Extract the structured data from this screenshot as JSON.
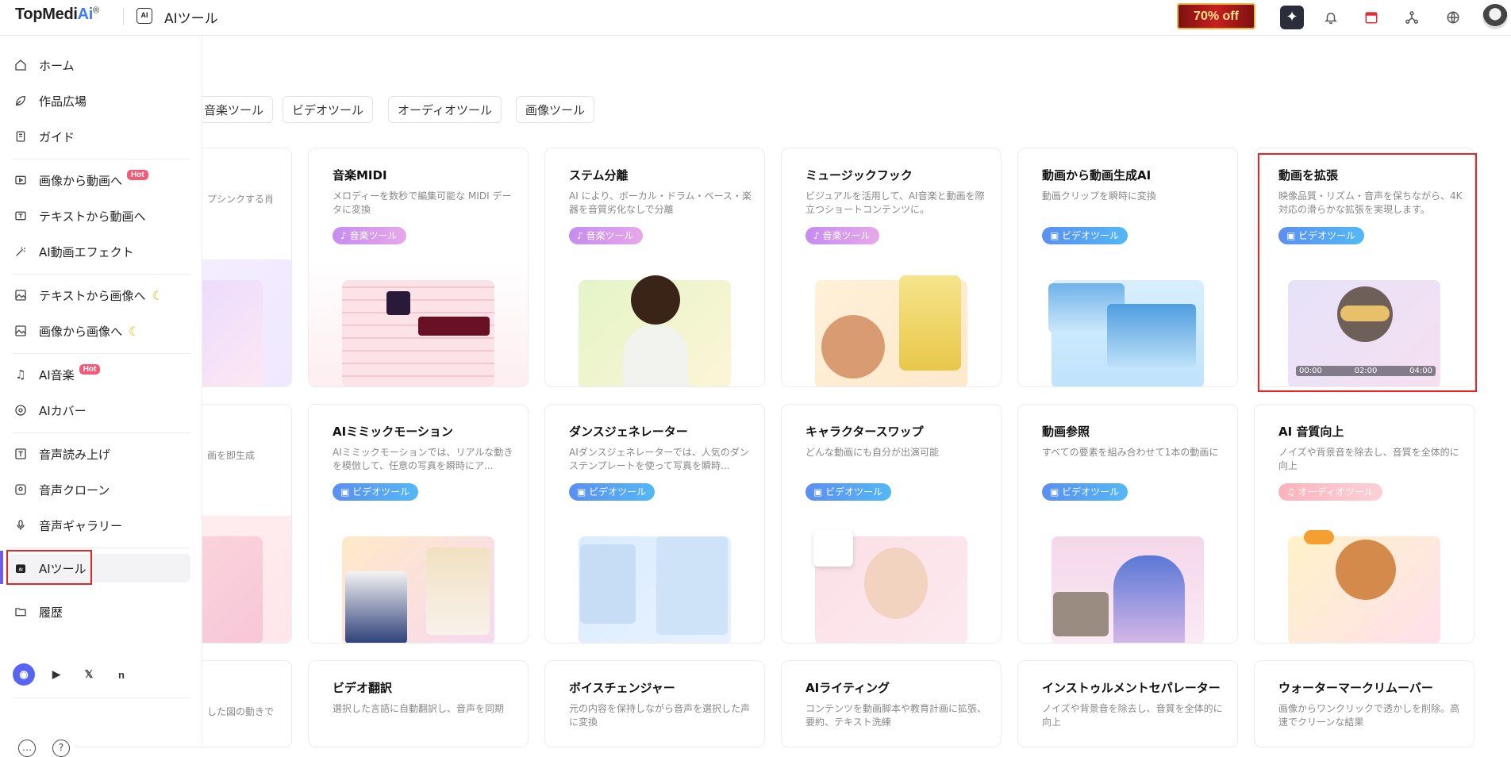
{
  "app": {
    "logo_main": "TopMedi",
    "logo_ai": "Ai",
    "logo_reg": "®",
    "section_icon": "AI",
    "section_title": "AIツール",
    "promo_label": "70% off"
  },
  "sidebar": {
    "items": [
      {
        "label": "ホーム",
        "icon": "home-icon"
      },
      {
        "label": "作品広場",
        "icon": "leaf-icon"
      },
      {
        "label": "ガイド",
        "icon": "guide-icon"
      },
      {
        "label": "画像から動画へ",
        "icon": "image-video-icon",
        "badge": "Hot"
      },
      {
        "label": "テキストから動画へ",
        "icon": "text-video-icon"
      },
      {
        "label": "AI動画エフェクト",
        "icon": "magic-wand-icon"
      },
      {
        "label": "テキストから画像へ",
        "icon": "text-image-icon"
      },
      {
        "label": "画像から画像へ",
        "icon": "image-image-icon"
      },
      {
        "label": "AI音楽",
        "icon": "music-note-icon",
        "badge": "Hot"
      },
      {
        "label": "AIカバー",
        "icon": "disc-icon"
      },
      {
        "label": "音声読み上げ",
        "icon": "tts-icon"
      },
      {
        "label": "音声クローン",
        "icon": "voice-clone-icon"
      },
      {
        "label": "音声ギャラリー",
        "icon": "microphone-icon"
      },
      {
        "label": "AIツール",
        "icon": "ai-tools-icon"
      },
      {
        "label": "履歴",
        "icon": "folder-icon"
      }
    ],
    "social": [
      "discord-icon",
      "youtube-icon",
      "x-icon",
      "note-icon"
    ]
  },
  "categories": [
    "音楽ツール",
    "ビデオツール",
    "オーディオツール",
    "画像ツール"
  ],
  "tags": {
    "music": "音楽ツール",
    "video": "ビデオツール",
    "audio": "オーディオツール"
  },
  "partial_cards": [
    {
      "desc": "プシンクする肖"
    },
    {
      "desc": "画を即生成"
    },
    {
      "desc": "した図の動きで"
    }
  ],
  "cards": [
    {
      "title": "音楽MIDI",
      "desc": "メロディーを数秒で編集可能な MIDI データに変換",
      "tag": "音楽ツール"
    },
    {
      "title": "ステム分離",
      "desc": "AI により、ボーカル・ドラム・ベース・楽器を音質劣化なしで分離",
      "tag": "音楽ツール"
    },
    {
      "title": "ミュージックフック",
      "desc": "ビジュアルを活用して、AI音楽と動画を際立つショートコンテンツに。",
      "tag": "音楽ツール"
    },
    {
      "title": "動画から動画生成AI",
      "desc": "動画クリップを瞬時に変換",
      "tag": "ビデオツール"
    },
    {
      "title": "動画を拡張",
      "desc": "映像品質・リズム・音声を保ちながら、4K対応の滑らかな拡張を実現します。",
      "tag": "ビデオツール",
      "times": [
        "00:00",
        "02:00",
        "04:00"
      ]
    },
    {
      "title": "AIミミックモーション",
      "desc": "AIミミックモーションでは、リアルな動きを模倣して、任意の写真を瞬時にア...",
      "tag": "ビデオツール"
    },
    {
      "title": "ダンスジェネレーター",
      "desc": "AIダンスジェネレーターでは、人気のダンステンプレートを使って写真を瞬時...",
      "tag": "ビデオツール"
    },
    {
      "title": "キャラクタースワップ",
      "desc": "どんな動画にも自分が出演可能",
      "tag": "ビデオツール"
    },
    {
      "title": "動画参照",
      "desc": "すべての要素を組み合わせて1本の動画に",
      "tag": "ビデオツール"
    },
    {
      "title": "AI 音質向上",
      "desc": "ノイズや背景音を除去し、音質を全体的に向上",
      "tag": "オーディオツール"
    },
    {
      "title": "ビデオ翻訳",
      "desc": "選択した言語に自動翻訳し、音声を同期"
    },
    {
      "title": "ボイスチェンジャー",
      "desc": "元の内容を保持しながら音声を選択した声に変換"
    },
    {
      "title": "AIライティング",
      "desc": "コンテンツを動画脚本や教育計画に拡張、要約、テキスト洗練"
    },
    {
      "title": "インストゥルメントセパレーター",
      "desc": "ノイズや背景音を除去し、音質を全体的に向上"
    },
    {
      "title": "ウォーターマークリムーバー",
      "desc": "画像からワンクリックで透かしを削除。高速でクリーンな結果"
    }
  ],
  "colors": {
    "accent": "#3d7bff",
    "highlight": "#e22222",
    "hot": "#f45a78"
  }
}
